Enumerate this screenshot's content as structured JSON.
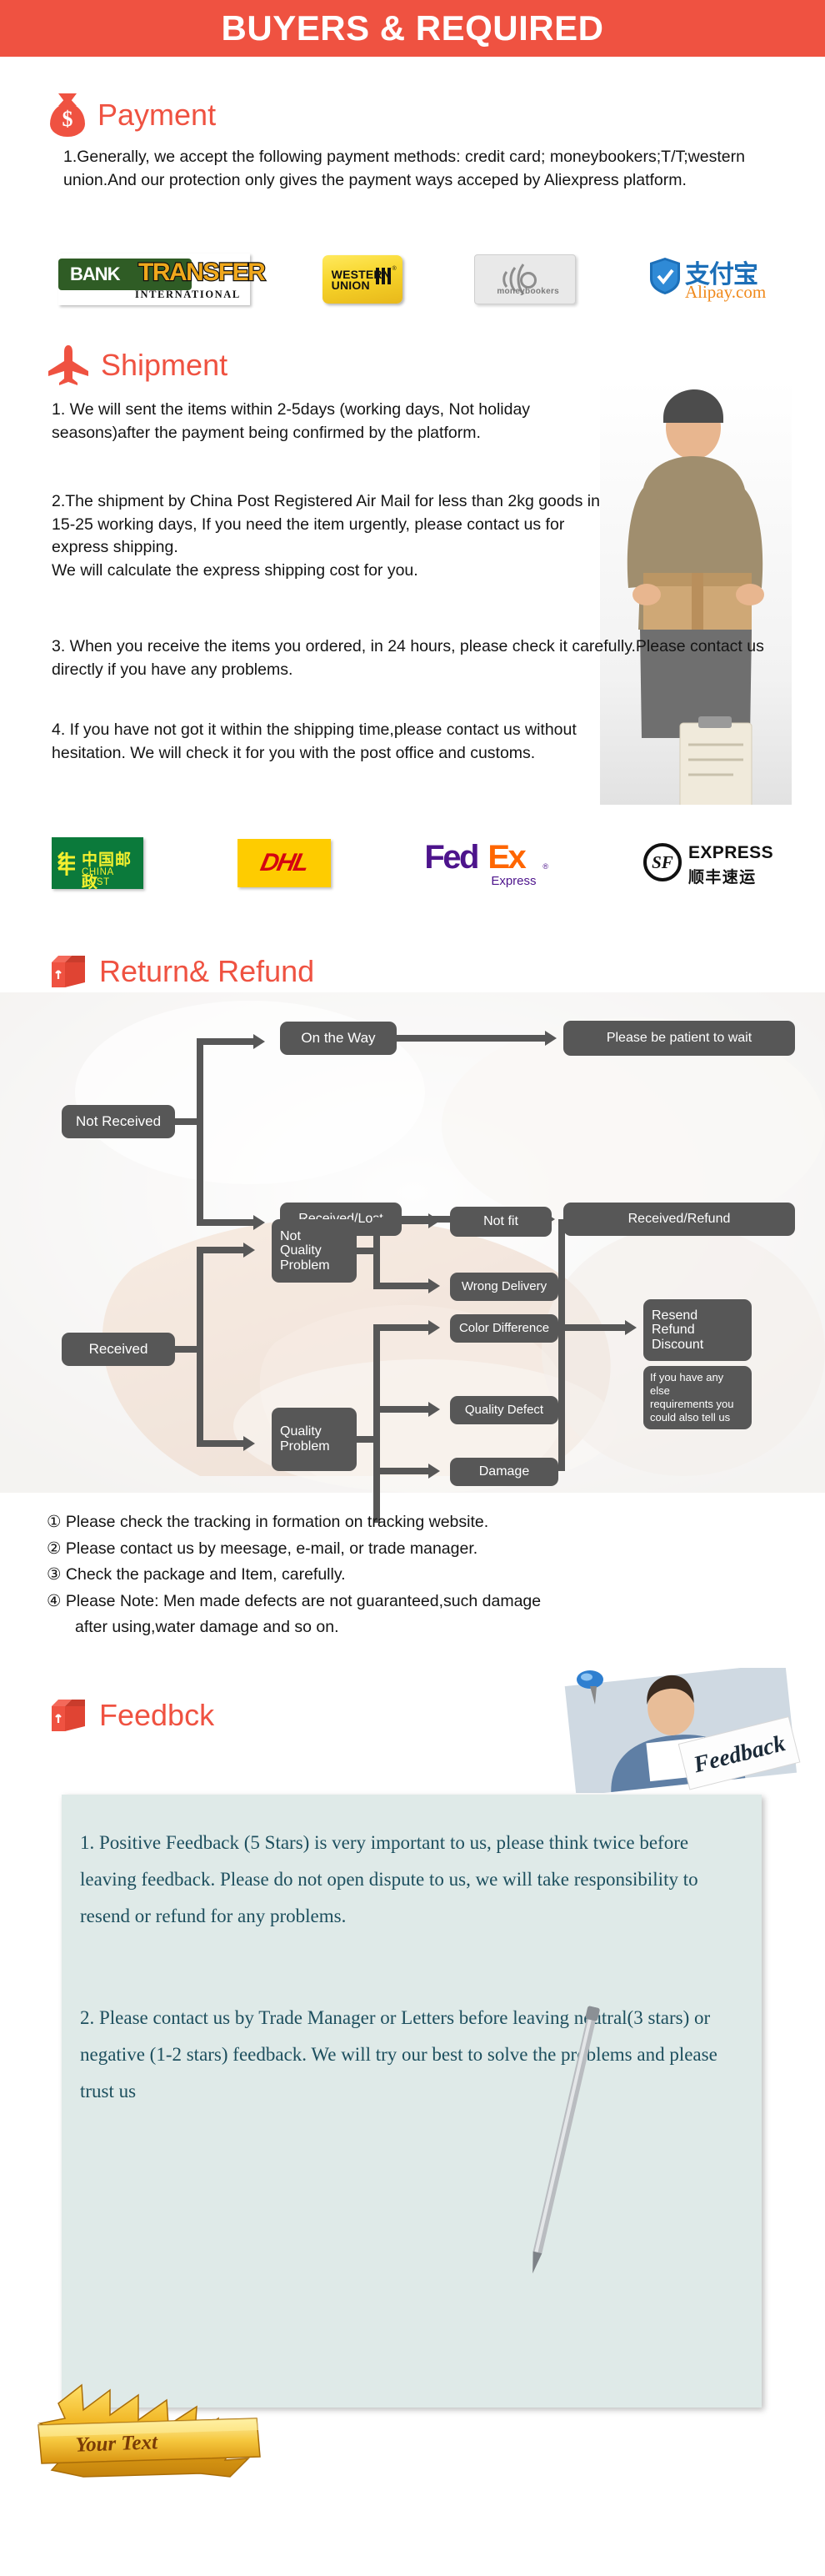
{
  "banner": {
    "title": "BUYERS & REQUIRED",
    "bg": "#ef5241"
  },
  "accent": "#ef5241",
  "payment": {
    "heading": "Payment",
    "icon": "money-bag-icon",
    "body": "1.Generally, we accept the following payment methods: credit card; moneybookers;T/T;western union.And our protection only gives the payment ways acceped by Aliexpress platform.",
    "logos": [
      {
        "name": "bank-transfer-logo",
        "line1": "BANK",
        "line2": "TRANSFER",
        "line3": "INTERNATIONAL"
      },
      {
        "name": "western-union-logo",
        "line1": "WESTERN",
        "line2": "UNION",
        "reg": "®"
      },
      {
        "name": "moneybookers-logo",
        "label": "moneybookers"
      },
      {
        "name": "alipay-logo",
        "cn": "支付宝",
        "com": "Alipay.com"
      }
    ]
  },
  "shipment": {
    "heading": "Shipment",
    "icon": "airplane-icon",
    "paragraphs": [
      "1. We will sent the items within 2-5days (working days, Not holiday seasons)after the payment being confirmed by the platform.",
      "2.The shipment by China Post Registered Air Mail for less than  2kg goods in 15-25 working days, If  you need the item urgently, please contact us for express shipping.\nWe will calculate the express shipping cost for you.",
      "3. When you receive the items you ordered, in 24 hours, please check  it carefully.Please contact us directly if you have any problems.",
      "4. If you have not got it within the shipping time,please contact us without hesitation. We will check it for you with the post office and customs."
    ],
    "logos": [
      {
        "name": "china-post-logo",
        "cn": "中国邮政",
        "en": "CHINA POST"
      },
      {
        "name": "dhl-logo",
        "text": "DHL"
      },
      {
        "name": "fedex-logo",
        "fed": "Fed",
        "ex": "Ex",
        "sub": "Express",
        "reg": "®"
      },
      {
        "name": "sf-express-logo",
        "mark": "SF",
        "en": "EXPRESS",
        "cn": "顺丰速运"
      }
    ]
  },
  "return_refund": {
    "heading": "Return& Refund",
    "icon": "return-box-icon",
    "flow": {
      "nodes": [
        {
          "id": "not-received",
          "label": "Not Received"
        },
        {
          "id": "on-the-way",
          "label": "On the Way"
        },
        {
          "id": "received-lost",
          "label": "Received/Lost"
        },
        {
          "id": "be-patient",
          "label": "Please be patient to wait"
        },
        {
          "id": "received-refund",
          "label": "Received/Refund"
        },
        {
          "id": "received",
          "label": "Received"
        },
        {
          "id": "not-quality-problem",
          "label": "Not\nQuality\nProblem"
        },
        {
          "id": "quality-problem",
          "label": "Quality\nProblem"
        },
        {
          "id": "not-fit",
          "label": "Not fit"
        },
        {
          "id": "wrong-delivery",
          "label": "Wrong Delivery"
        },
        {
          "id": "color-difference",
          "label": "Color Difference"
        },
        {
          "id": "quality-defect",
          "label": "Quality Defect"
        },
        {
          "id": "damage",
          "label": "Damage"
        },
        {
          "id": "resend-refund-discount",
          "label": "Resend\nRefund\nDiscount"
        },
        {
          "id": "tell-us",
          "label": "If you have any else\nrequirements you\ncould also tell us"
        }
      ]
    },
    "notes": [
      {
        "num": "①",
        "text": "Please check the tracking in formation on tracking website."
      },
      {
        "num": "②",
        "text": "Please contact us by meesage, e-mail, or trade manager."
      },
      {
        "num": "③",
        "text": "Check the package and Item, carefully."
      },
      {
        "num": "④",
        "text": "Please Note: Men made defects  are not guaranteed,such damage",
        "cont": "after using,water damage and so on."
      }
    ]
  },
  "feedback": {
    "heading": "Feedbck",
    "icon": "feedback-box-icon",
    "photo_label": "Feedback",
    "paragraphs": [
      "1. Positive Feedback (5 Stars) is very important to us, please think twice before leaving feedback. Please do not open dispute to us,   we will take responsibility to resend or refund for any problems.",
      "2. Please contact us by Trade Manager or Letters before leaving neutral(3 stars) or negative (1-2 stars) feedback. We will try our best to solve the problems and please trust us"
    ],
    "panel_bg": "#dfeae8",
    "text_color": "#1d4f5e",
    "ribbon_text": "Your Text"
  }
}
